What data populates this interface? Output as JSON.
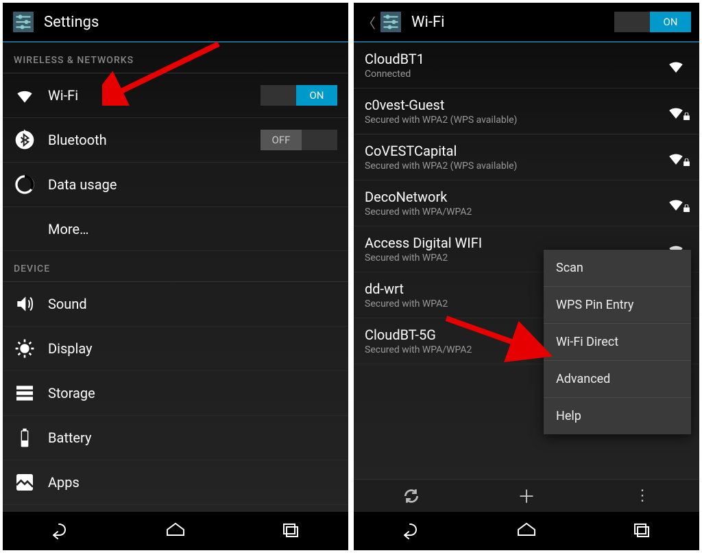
{
  "left": {
    "title": "Settings",
    "sections": {
      "wireless": "WIRELESS & NETWORKS",
      "device": "DEVICE"
    },
    "items": {
      "wifi": "Wi-Fi",
      "bluetooth": "Bluetooth",
      "data": "Data usage",
      "more": "More…",
      "sound": "Sound",
      "display": "Display",
      "storage": "Storage",
      "battery": "Battery",
      "apps": "Apps"
    },
    "toggle": {
      "on": "ON",
      "off": "OFF"
    }
  },
  "right": {
    "title": "Wi-Fi",
    "toggle_on": "ON",
    "networks": [
      {
        "name": "CloudBT1",
        "sub": "Connected"
      },
      {
        "name": "c0vest-Guest",
        "sub": "Secured with WPA2 (WPS available)"
      },
      {
        "name": "CoVESTCapital",
        "sub": "Secured with WPA2 (WPS available)"
      },
      {
        "name": "DecoNetwork",
        "sub": "Secured with WPA/WPA2"
      },
      {
        "name": "Access Digital WIFI",
        "sub": "Secured with WPA2"
      },
      {
        "name": "dd-wrt",
        "sub": "Secured with WPA2"
      },
      {
        "name": "CloudBT-5G",
        "sub": "Secured with WPA/WPA2"
      }
    ],
    "menu": {
      "scan": "Scan",
      "wps": "WPS Pin Entry",
      "direct": "Wi-Fi Direct",
      "advanced": "Advanced",
      "help": "Help"
    }
  },
  "colors": {
    "accent": "#0099cc",
    "arrow": "#e60000"
  }
}
